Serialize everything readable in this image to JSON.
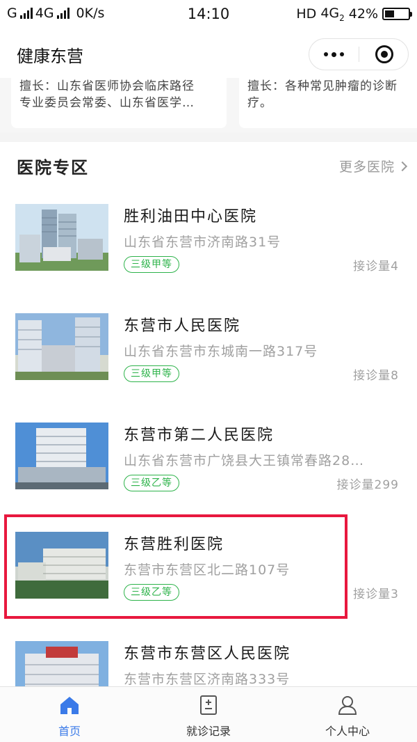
{
  "status_bar": {
    "carrier_1": "G",
    "network": "4G",
    "speed": "0K/s",
    "time": "14:10",
    "hd": "HD",
    "net_right": "4G",
    "net_sub": "2",
    "battery": "42%",
    "battery_level": 0.42
  },
  "header": {
    "title": "健康东营"
  },
  "doctor_cards": [
    {
      "specialty_lines": [
        "擅长：山东省医师协会临床路径",
        "专业委员会常委、山东省医学…"
      ]
    },
    {
      "specialty_lines": [
        "擅长：各种常见肿瘤的诊断",
        "疗。"
      ]
    }
  ],
  "section": {
    "title": "医院专区",
    "more_label": "更多医院"
  },
  "hospitals": [
    {
      "name": "胜利油田中心医院",
      "address": "山东省东营市济南路31号",
      "grade": "三级甲等",
      "visits": "接诊量4"
    },
    {
      "name": "东营市人民医院",
      "address": "山东省东营市东城南一路317号",
      "grade": "三级甲等",
      "visits": "接诊量8"
    },
    {
      "name": "东营市第二人民医院",
      "address": "山东省东营市广饶县大王镇常春路28…",
      "grade": "三级乙等",
      "visits": "接诊量299"
    },
    {
      "name": "东营胜利医院",
      "address": "东营市东营区北二路107号",
      "grade": "三级乙等",
      "visits": "接诊量3"
    },
    {
      "name": "东营市东营区人民医院",
      "address": "东营市东营区济南路333号",
      "grade": "",
      "visits": ""
    }
  ],
  "tabs": [
    {
      "label": "首页",
      "icon": "home-icon",
      "active": true
    },
    {
      "label": "就诊记录",
      "icon": "record-icon",
      "active": false
    },
    {
      "label": "个人中心",
      "icon": "user-icon",
      "active": false
    }
  ],
  "colors": {
    "accent": "#3a7ae8",
    "grade_green": "#2db34a",
    "highlight_red": "#e8183e"
  }
}
